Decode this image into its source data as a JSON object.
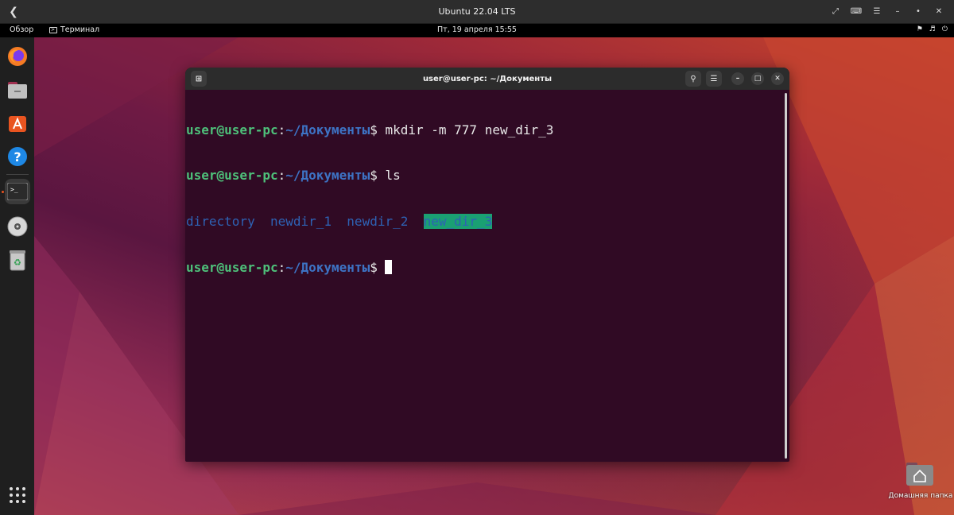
{
  "vm_window": {
    "title": "Ubuntu 22.04 LTS",
    "back_icon": "chevron-left-icon",
    "controls": [
      "fullscreen-icon",
      "keyboard-icon",
      "menu-icon",
      "minimize-icon",
      "settings-icon",
      "close-icon"
    ]
  },
  "top_panel": {
    "overview_label": "Обзор",
    "app_label": "Терминал",
    "clock": "Пт, 19 апреля  15:55"
  },
  "dock": {
    "items": [
      "firefox-icon",
      "files-icon",
      "app-center-icon",
      "help-icon",
      "terminal-icon",
      "disc-icon",
      "trash-icon"
    ],
    "apps_grid": "show-apps-icon"
  },
  "terminal": {
    "title": "user@user-pc: ~/Документы",
    "prompt_user": "user@user-pc",
    "prompt_colon": ":",
    "prompt_path": "~/Документы",
    "prompt_symbol": "$ ",
    "cmd1": "mkdir -m 777 new_dir_3",
    "cmd2": "ls",
    "ls_output": [
      "directory",
      "newdir_1",
      "newdir_2",
      "new_dir_3"
    ],
    "colors": {
      "background": "#300a24",
      "user": "#4ec07a",
      "path": "#3d73c4",
      "highlight_bg": "#1aa073"
    }
  },
  "desktop": {
    "home_folder_label": "Домашняя папка"
  }
}
